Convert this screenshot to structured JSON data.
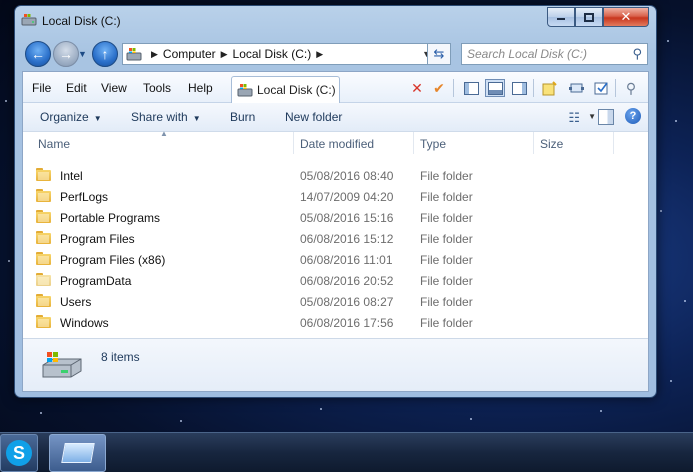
{
  "window": {
    "title": "Local Disk (C:)"
  },
  "address": {
    "crumbs": [
      "Computer",
      "Local Disk (C:)"
    ]
  },
  "search": {
    "placeholder": "Search Local Disk (C:)"
  },
  "menu": {
    "items": [
      "File",
      "Edit",
      "View",
      "Tools",
      "Help"
    ],
    "tab_label": "Local Disk (C:)"
  },
  "commands": {
    "organize": "Organize",
    "share_with": "Share with",
    "burn": "Burn",
    "new_folder": "New folder"
  },
  "columns": {
    "name": "Name",
    "date": "Date modified",
    "type": "Type",
    "size": "Size"
  },
  "files": [
    {
      "name": "Intel",
      "date": "05/08/2016 08:40",
      "type": "File folder"
    },
    {
      "name": "PerfLogs",
      "date": "14/07/2009 04:20",
      "type": "File folder"
    },
    {
      "name": "Portable Programs",
      "date": "05/08/2016 15:16",
      "type": "File folder"
    },
    {
      "name": "Program Files",
      "date": "06/08/2016 15:12",
      "type": "File folder"
    },
    {
      "name": "Program Files (x86)",
      "date": "06/08/2016 11:01",
      "type": "File folder"
    },
    {
      "name": "ProgramData",
      "date": "06/08/2016 20:52",
      "type": "File folder",
      "hidden": true
    },
    {
      "name": "Users",
      "date": "05/08/2016 08:27",
      "type": "File folder"
    },
    {
      "name": "Windows",
      "date": "06/08/2016 17:56",
      "type": "File folder"
    }
  ],
  "details": {
    "item_count": "8 items"
  },
  "icons": {
    "back": "back-arrow-icon",
    "forward": "forward-arrow-icon",
    "up": "up-arrow-icon",
    "refresh": "refresh-icon",
    "search": "search-icon",
    "help": "help-icon",
    "delete": "delete-x-icon",
    "check": "checkmark-icon"
  },
  "colors": {
    "accent": "#2a6fc9",
    "folder": "#e8b23a",
    "close": "#c8361e"
  }
}
